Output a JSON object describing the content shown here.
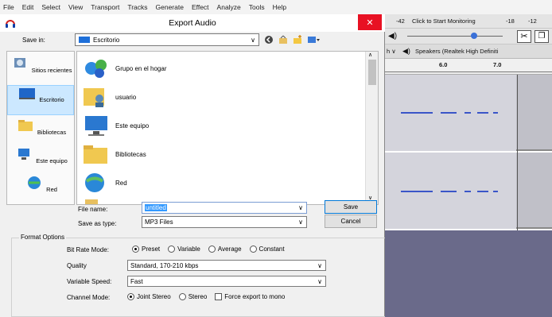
{
  "menubar": {
    "items": [
      "File",
      "Edit",
      "Select",
      "View",
      "Transport",
      "Tracks",
      "Generate",
      "Effect",
      "Analyze",
      "Tools",
      "Help"
    ]
  },
  "dialog": {
    "title": "Export Audio",
    "close_label": "✕",
    "save_in_label": "Save in:",
    "save_in_value": "Escritorio",
    "places": [
      {
        "label": "Sitios recientes"
      },
      {
        "label": "Escritorio"
      },
      {
        "label": "Bibliotecas"
      },
      {
        "label": "Este equipo"
      },
      {
        "label": "Red"
      }
    ],
    "files": [
      {
        "label": "Grupo en el hogar"
      },
      {
        "label": "usuario"
      },
      {
        "label": "Este equipo"
      },
      {
        "label": "Bibliotecas"
      },
      {
        "label": "Red"
      }
    ],
    "file_name_label": "File name:",
    "file_name_value": "untitled",
    "save_as_type_label": "Save as type:",
    "save_as_type_value": "MP3 Files",
    "save_label": "Save",
    "cancel_label": "Cancel"
  },
  "format_options": {
    "title": "Format Options",
    "bit_rate_mode_label": "Bit Rate Mode:",
    "bit_rate_modes": [
      "Preset",
      "Variable",
      "Average",
      "Constant"
    ],
    "bit_rate_mode_selected": "Preset",
    "quality_label": "Quality",
    "quality_value": "Standard, 170-210 kbps",
    "variable_speed_label": "Variable Speed:",
    "variable_speed_value": "Fast",
    "channel_mode_label": "Channel Mode:",
    "channel_modes": [
      "Joint Stereo",
      "Stereo"
    ],
    "channel_mode_selected": "Joint Stereo",
    "force_mono_label": "Force export to mono"
  },
  "audacity": {
    "meter_start": "-42",
    "monitor_label": "Click to Start Monitoring",
    "meter_18": "-18",
    "meter_12": "-12",
    "output_device": "Speakers (Realtek High Definiti",
    "ruler_6": "6.0",
    "ruler_7": "7.0"
  },
  "colors": {
    "accent": "#0078d7",
    "close": "#e81123",
    "waveform": "#3a55c8"
  }
}
